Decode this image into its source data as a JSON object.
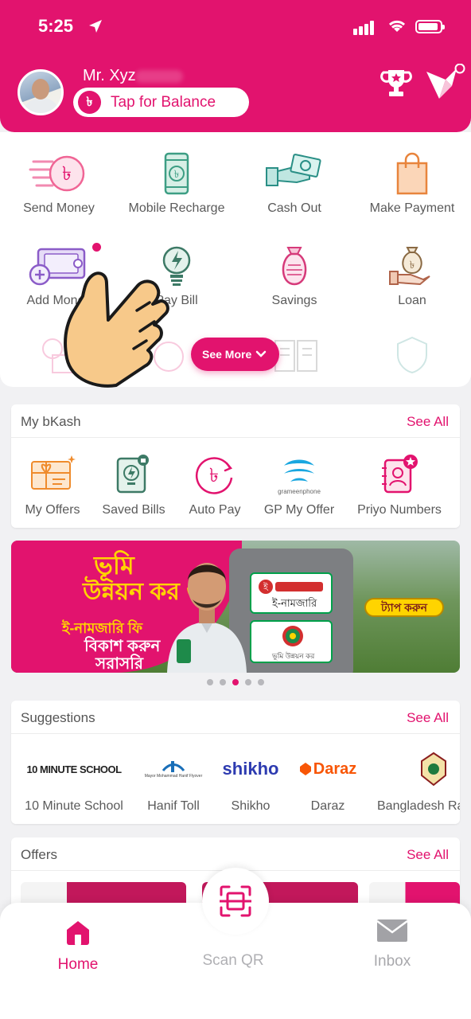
{
  "status_bar": {
    "time": "5:25"
  },
  "header": {
    "user_name": "Mr. Xyz",
    "balance_button": "Tap for Balance",
    "taka_symbol": "৳"
  },
  "services": {
    "row1": [
      "Send Money",
      "Mobile Recharge",
      "Cash Out",
      "Make Payment"
    ],
    "row2": [
      "Add Money",
      "Pay Bill",
      "Savings",
      "Loan"
    ],
    "see_more": "See More"
  },
  "my_bkash": {
    "title": "My bKash",
    "see_all": "See All",
    "items": [
      "My Offers",
      "Saved Bills",
      "Auto Pay",
      "GP My Offer",
      "Priyo Numbers"
    ],
    "gp_brand": "grameenphone"
  },
  "banner": {
    "line1": "ভূমি",
    "line2": "উন্নয়ন কর ও",
    "line3": "ই-নামজারি ফি",
    "line4": "বিকাশ করুন",
    "line5": "সরাসরি",
    "card1": "ই-নামজারি",
    "card2": "ভূমি উন্নয়ন কর",
    "cta": "ট্যাপ করুন",
    "active_slide": 3,
    "total_slides": 5
  },
  "suggestions": {
    "title": "Suggestions",
    "see_all": "See All",
    "items": [
      "10 Minute School",
      "Hanif Toll",
      "Shikho",
      "Daraz",
      "Bangladesh Ra"
    ],
    "logo_10ms": "10 MINUTE SCHOOL",
    "logo_hanif": "Mayor Mohammad Hanif Flyover",
    "logo_shikho": "shikho",
    "logo_daraz": "Daraz"
  },
  "offers": {
    "title": "Offers",
    "see_all": "See All"
  },
  "bottom_nav": {
    "home": "Home",
    "scan": "Scan QR",
    "inbox": "Inbox"
  },
  "colors": {
    "brand": "#e2136e",
    "accent_yellow": "#ffd400"
  }
}
